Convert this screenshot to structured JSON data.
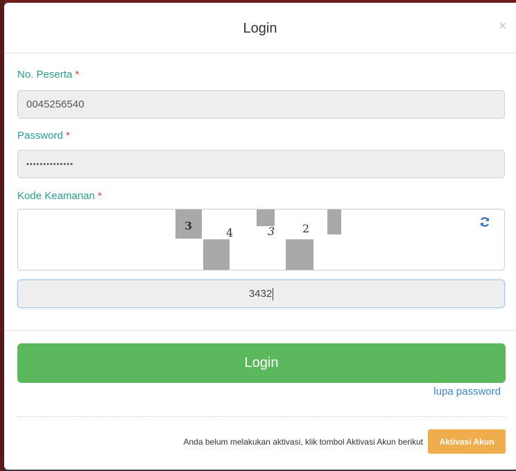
{
  "modal": {
    "title": "Login",
    "close_symbol": "×"
  },
  "form": {
    "participant_label": "No. Peserta",
    "participant_value": "0045256540",
    "password_label": "Password",
    "password_value": "••••••••••••••",
    "captcha_label": "Kode Keamanan",
    "required_mark": "*",
    "captcha_chars": [
      "3",
      "4",
      "3",
      "2"
    ],
    "captcha_value": "3432"
  },
  "actions": {
    "login_label": "Login",
    "forgot_password_label": "lupa password",
    "activation_text": "Anda belum melakukan aktivasi, klik tombol Aktivasi Akun berikut",
    "activation_button_label": "Aktivasi Akun"
  },
  "colors": {
    "label": "#2a9d8f",
    "required": "#e03b3b",
    "primary_button": "#5cb85c",
    "warning_button": "#f0ad4e",
    "link": "#3a87c9"
  },
  "icons": {
    "refresh": "refresh-icon",
    "close": "close-icon"
  }
}
